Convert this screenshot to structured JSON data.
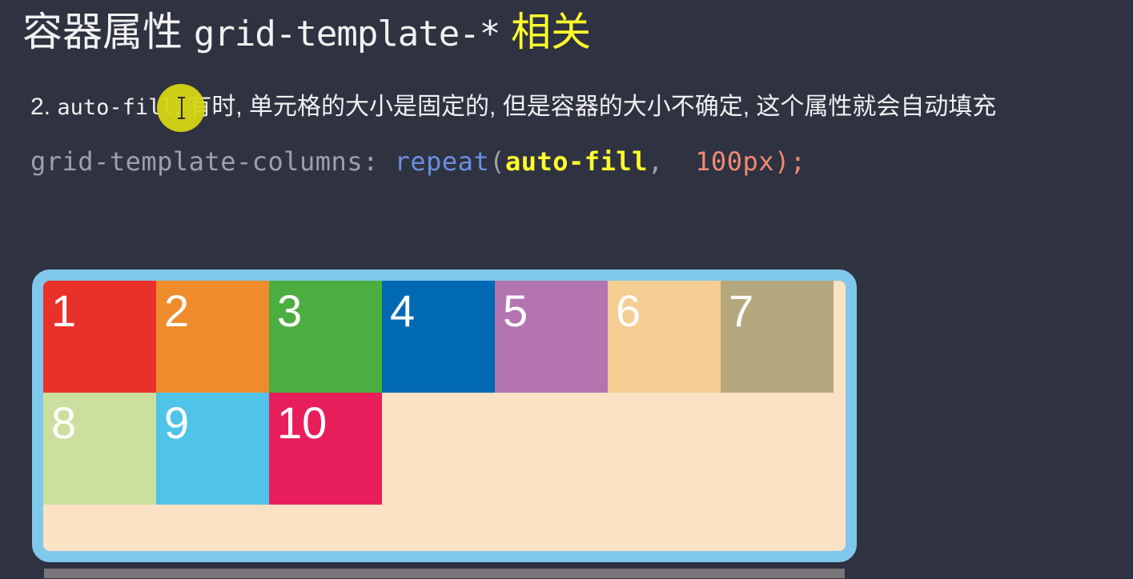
{
  "theme": {
    "background": "#2f3240",
    "title_color": "#f2f2f2",
    "accent_yellow": "#ffff2e",
    "body_text_color": "#f0f0f2",
    "container_border": "#7fc8ec",
    "container_background": "#fce2c4",
    "spotlight_color": "#d6d614",
    "scrollbar_thumb": "#7a7578"
  },
  "title": {
    "prefix": "容器属性",
    "code": "grid-template-*",
    "suffix": "相关"
  },
  "body": {
    "number": "2.",
    "term": "auto-fill",
    "text": ",  有时,  单元格的大小是固定的,  但是容器的大小不确定,  这个属性就会自动填充"
  },
  "cursor": {
    "icon": "text-ibeam-cursor",
    "spotlight": "click-highlight"
  },
  "code_line": {
    "property": "grid-template-columns:",
    "space1": " ",
    "function": "repeat",
    "open_paren": "(",
    "keyword": "auto-fill",
    "comma": ",",
    "space2": "  ",
    "value": "100px",
    "close_paren": ")",
    "semicolon": ";"
  },
  "grid_demo": {
    "columns_rule": "repeat(auto-fill, 100px)",
    "items": [
      {
        "label": "1",
        "color": "#e8312a"
      },
      {
        "label": "2",
        "color": "#ee8c2b"
      },
      {
        "label": "3",
        "color": "#4cad40"
      },
      {
        "label": "4",
        "color": "#0069b4"
      },
      {
        "label": "5",
        "color": "#b374b0"
      },
      {
        "label": "6",
        "color": "#f5ce94"
      },
      {
        "label": "7",
        "color": "#b5a87e"
      },
      {
        "label": "8",
        "color": "#cbe09e"
      },
      {
        "label": "9",
        "color": "#4fc3e8"
      },
      {
        "label": "10",
        "color": "#e81e5c"
      }
    ]
  },
  "scrollbar": {
    "orientation": "horizontal",
    "name": "page-horizontal-scrollbar"
  }
}
